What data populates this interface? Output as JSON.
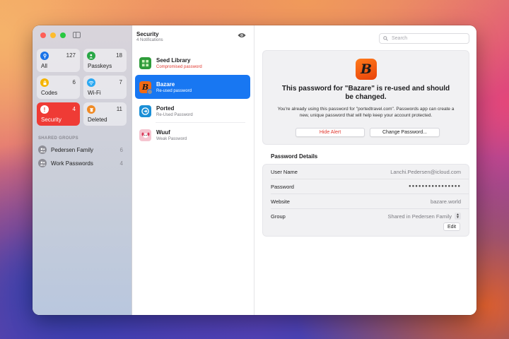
{
  "sidebar": {
    "tiles": [
      {
        "label": "All",
        "count": "127",
        "icon": "key-icon",
        "color": "#1a73e8"
      },
      {
        "label": "Passkeys",
        "count": "18",
        "icon": "person-key-icon",
        "color": "#28a745"
      },
      {
        "label": "Codes",
        "count": "6",
        "icon": "lock-code-icon",
        "color": "#f5b400"
      },
      {
        "label": "Wi-Fi",
        "count": "7",
        "icon": "wifi-icon",
        "color": "#2aa8f2"
      },
      {
        "label": "Security",
        "count": "4",
        "icon": "exclamation-icon",
        "color": "#ef3b35",
        "active": true
      },
      {
        "label": "Deleted",
        "count": "11",
        "icon": "trash-icon",
        "color": "#f08a24"
      }
    ],
    "groups_header": "SHARED GROUPS",
    "groups": [
      {
        "label": "Pedersen Family",
        "count": "6"
      },
      {
        "label": "Work Passwords",
        "count": "4"
      }
    ]
  },
  "list": {
    "title": "Security",
    "subtitle": "4 Notifications",
    "items": [
      {
        "title": "Seed Library",
        "subtitle": "Compromised password",
        "icon": "seed-library-icon",
        "color": "#2e9c3a"
      },
      {
        "title": "Bazare",
        "subtitle": "Re-used password",
        "icon": "bazare-icon",
        "color": "#f06a14"
      },
      {
        "title": "Ported",
        "subtitle": "Re-Used Password",
        "icon": "ported-icon",
        "color": "#1a8fd6"
      },
      {
        "title": "Wuuf",
        "subtitle": "Weak Password",
        "icon": "wuuf-icon",
        "color": "#f5c5d0"
      }
    ]
  },
  "detail": {
    "search_placeholder": "Search",
    "alert": {
      "logo_letter": "B",
      "title": "This password for \"Bazare\" is re-used and should be changed.",
      "body": "You're already using this password for \"portedtravel.com\". Passwords app can create a new, unique password that will help keep your account protected.",
      "hide_label": "Hide Alert",
      "change_label": "Change Password..."
    },
    "details_title": "Password Details",
    "fields": [
      {
        "key": "User Name",
        "value": "Lanchi.Pedersen@icloud.com"
      },
      {
        "key": "Password",
        "value": "●●●●●●●●●●●●●●●●"
      },
      {
        "key": "Website",
        "value": "bazare.world"
      },
      {
        "key": "Group",
        "value": "Shared in Pedersen Family"
      }
    ],
    "edit_label": "Edit"
  }
}
